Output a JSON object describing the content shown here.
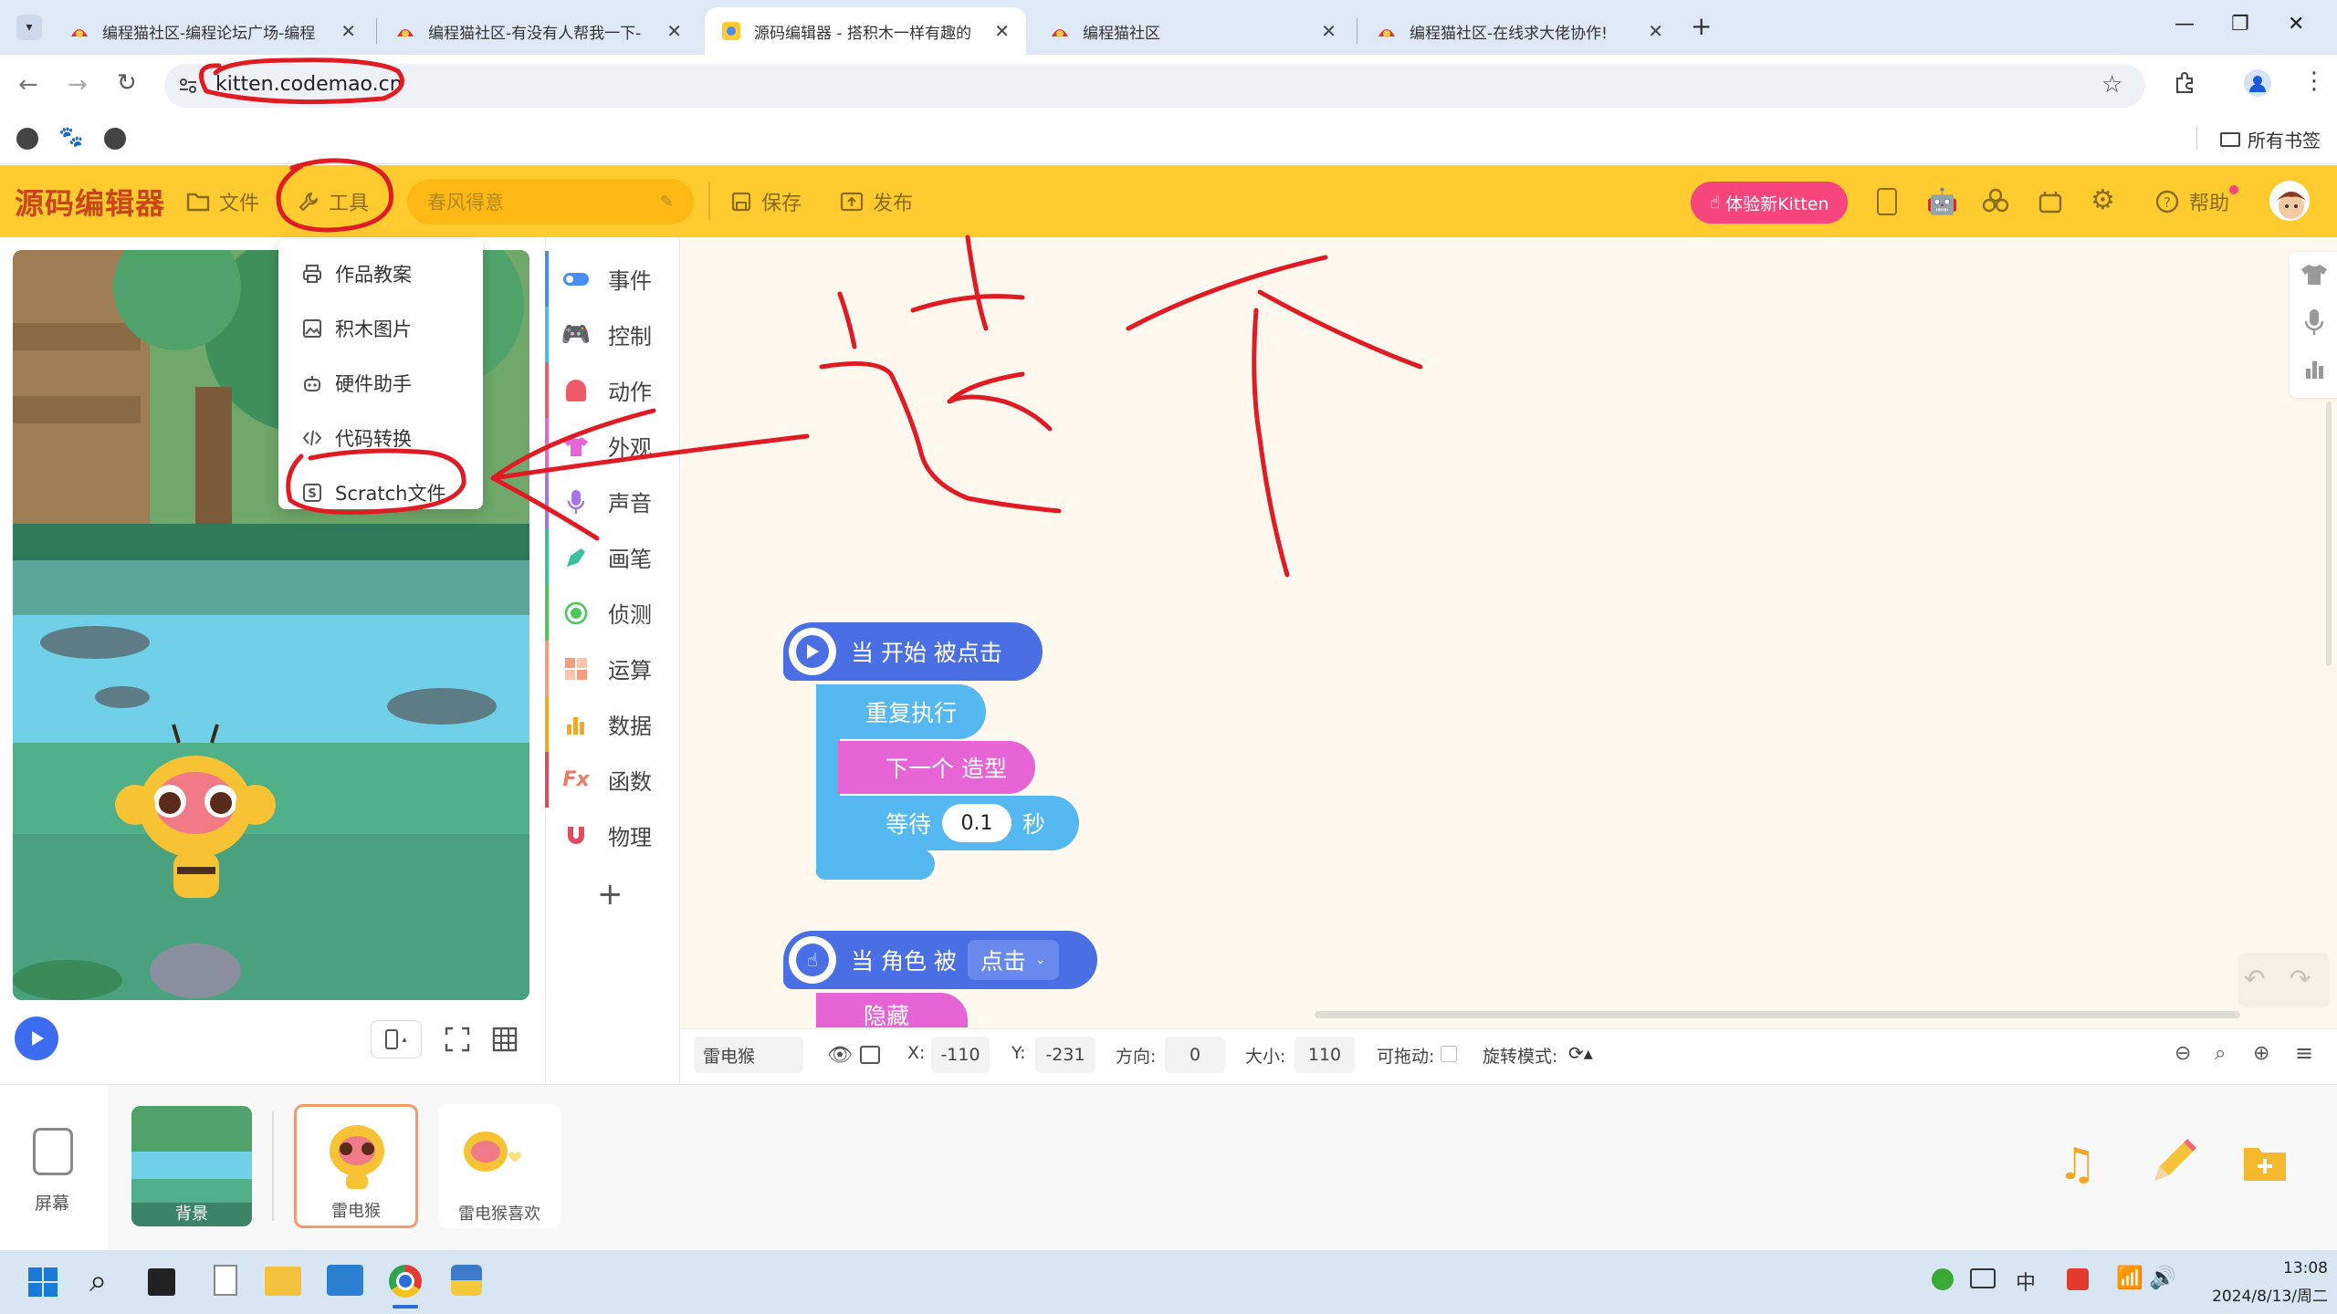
{
  "browser": {
    "tabs": [
      {
        "title": "编程猫社区-编程论坛广场-编程",
        "active": false
      },
      {
        "title": "编程猫社区-有没有人帮我一下-",
        "active": false
      },
      {
        "title": "源码编辑器 - 搭积木一样有趣的",
        "active": true
      },
      {
        "title": "编程猫社区",
        "active": false
      },
      {
        "title": "编程猫社区-在线求大佬协作!",
        "active": false
      }
    ],
    "url": "kitten.codemao.cn",
    "all_bookmarks": "所有书签"
  },
  "app": {
    "logo": "源码编辑器",
    "file": "文件",
    "tools": "工具",
    "project_name_placeholder": "春风得意",
    "save": "保存",
    "publish": "发布",
    "try_new": "体验新Kitten",
    "help": "帮助"
  },
  "tools_menu": [
    {
      "label": "作品教案",
      "icon": "printer-icon"
    },
    {
      "label": "积木图片",
      "icon": "image-icon"
    },
    {
      "label": "硬件助手",
      "icon": "robot-icon"
    },
    {
      "label": "代码转换",
      "icon": "code-icon"
    },
    {
      "label": "Scratch文件",
      "icon": "scratch-s-icon"
    }
  ],
  "categories": [
    {
      "label": "事件",
      "color": "#4a8cf5"
    },
    {
      "label": "控制",
      "color": "#4cb8ee"
    },
    {
      "label": "动作",
      "color": "#ee5a68"
    },
    {
      "label": "外观",
      "color": "#e566d8"
    },
    {
      "label": "声音",
      "color": "#a774e8"
    },
    {
      "label": "画笔",
      "color": "#3bbf9c"
    },
    {
      "label": "侦测",
      "color": "#4fc65a"
    },
    {
      "label": "运算",
      "color": "#f59d7c"
    },
    {
      "label": "数据",
      "color": "#f5a623"
    },
    {
      "label": "函数",
      "color": "#f07a6a"
    },
    {
      "label": "物理",
      "color": "#e04b5e"
    }
  ],
  "blocks": {
    "when_start_clicked": "当 开始 被点击",
    "forever": "重复执行",
    "next_costume": "下一个 造型",
    "wait": "等待",
    "wait_value": "0.1",
    "seconds": "秒",
    "when_sprite_clicked_pre": "当 角色 被",
    "when_sprite_clicked_opt": "点击",
    "hide": "隐藏"
  },
  "annotation": {
    "handwritten_text": "这个"
  },
  "sprite_props": {
    "name": "雷电猴",
    "x_label": "X:",
    "x": "-110",
    "y_label": "Y:",
    "y": "-231",
    "direction_label": "方向:",
    "direction": "0",
    "size_label": "大小:",
    "size": "110",
    "draggable_label": "可拖动:",
    "rotation_label": "旋转模式:"
  },
  "tray": {
    "screen_label": "屏幕",
    "items": [
      {
        "label": "背景"
      },
      {
        "label": "雷电猴"
      },
      {
        "label": "雷电猴喜欢"
      }
    ]
  },
  "taskbar": {
    "time": "13:08",
    "date": "2024/8/13/周二",
    "ime": "中"
  },
  "colors": {
    "appbar": "#ffcb2f",
    "event_block": "#4a6fe5",
    "control_block": "#56b8f0",
    "looks_block": "#e664d6",
    "annotation_red": "#e01b24"
  }
}
